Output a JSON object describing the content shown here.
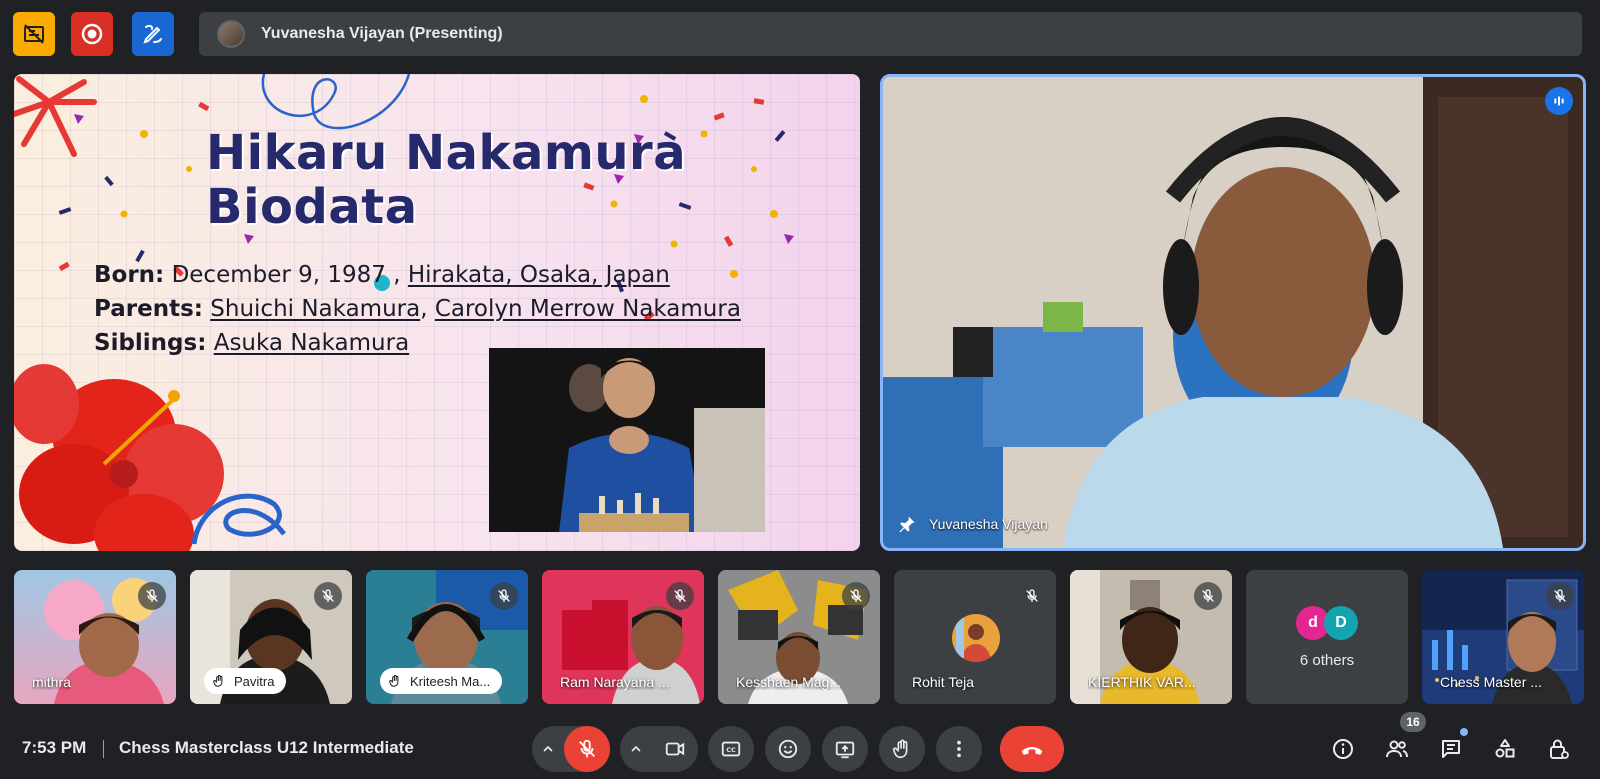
{
  "presenter": {
    "label": "Yuvanesha Vijayan (Presenting)"
  },
  "slide": {
    "title_line1": "Hikaru Nakamura",
    "title_line2": "Biodata",
    "born_label": "Born:",
    "born_date": "December 9, 1987 ,",
    "born_place": "Hirakata, Osaka, Japan",
    "parents_label": "Parents:",
    "parent1": "Shuichi Nakamura",
    "parents_sep": ",",
    "parent2": "Carolyn Merrow Nakamura",
    "siblings_label": "Siblings:",
    "sibling1": "Asuka Nakamura"
  },
  "main_video": {
    "name": "Yuvanesha Vijayan"
  },
  "tiles": [
    {
      "name": "mithra",
      "muted": true
    },
    {
      "name": "Pavitra",
      "muted": true,
      "hand_raised": true
    },
    {
      "name": "Kriteesh Ma...",
      "muted": true,
      "hand_raised": true
    },
    {
      "name": "Ram Narayana ...",
      "muted": true
    },
    {
      "name": "Kesshaen Mag...",
      "muted": true
    },
    {
      "name": "Rohit Teja",
      "muted": true
    },
    {
      "name": "KIERTHIK VAR...",
      "muted": true
    },
    {
      "name": "6 others",
      "initial1": "d",
      "initial2": "D"
    },
    {
      "name": "Chess Master ...",
      "muted": true
    }
  ],
  "footer": {
    "time": "7:53 PM",
    "meeting_title": "Chess Masterclass U12 Intermediate",
    "participant_count": "16"
  },
  "colors": {
    "background": "#202124",
    "surface": "#3c4043",
    "end_call": "#ea4335",
    "active_speaker": "#8ab4f8",
    "muted_red": "#ea4335",
    "top_yellow": "#f9ab00",
    "top_red": "#d93025",
    "top_blue": "#1967d2"
  },
  "icons": {
    "top": [
      "activities-icon",
      "record-icon",
      "whiteboard-icon"
    ],
    "controls": [
      "mic-off-icon",
      "camera-icon",
      "captions-icon",
      "emoji-icon",
      "present-icon",
      "raise-hand-icon",
      "more-options-icon",
      "end-call-icon"
    ],
    "right": [
      "info-icon",
      "people-icon",
      "chat-icon",
      "activities-shapes-icon",
      "host-controls-icon"
    ]
  }
}
